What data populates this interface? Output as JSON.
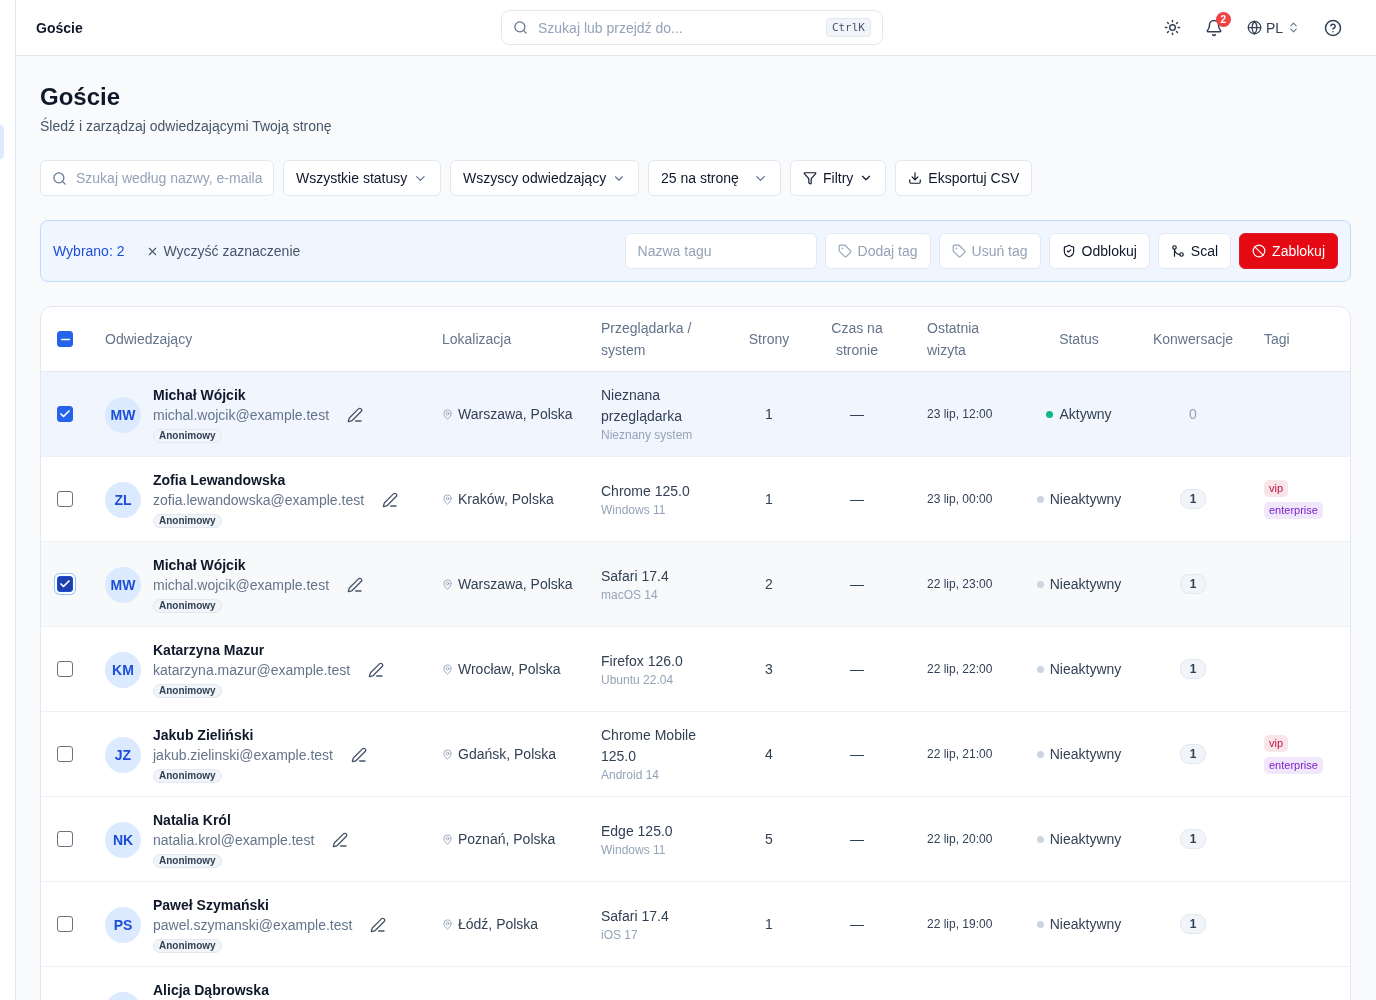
{
  "top_bar": {
    "title": "Goście",
    "search": {
      "placeholder": "Szukaj lub przejdź do...",
      "shortcut": "CtrlK"
    },
    "notifications": {
      "count": "2"
    },
    "language": "PL"
  },
  "page": {
    "title": "Goście",
    "subtitle": "Śledź i zarządzaj odwiedzającymi Twoją stronę"
  },
  "filters": {
    "search": {
      "placeholder": "Szukaj według nazwy, e-maila"
    },
    "selects": [
      "Wszystkie statusy",
      "Wszyscy odwiedzający",
      "25 na stronę"
    ],
    "buttons": [
      {
        "label": "Filtry",
        "kind": "menu"
      },
      {
        "label": "Eksportuj CSV",
        "kind": "export"
      }
    ]
  },
  "selection_bar": {
    "count_label": "Wybrano: 2",
    "clear_label": "Wyczyść zaznaczenie",
    "tag_input": {
      "placeholder": "Nazwa tagu"
    },
    "actions": [
      {
        "label": "Dodaj tag",
        "kind": "tag",
        "disabled": true
      },
      {
        "label": "Usuń tag",
        "kind": "tag",
        "disabled": true
      },
      {
        "label": "Odblokuj",
        "kind": "unblock",
        "disabled": false
      },
      {
        "label": "Scal",
        "kind": "merge",
        "disabled": false
      },
      {
        "label": "Zablokuj",
        "kind": "block",
        "disabled": false
      }
    ]
  },
  "table": {
    "select_all": {
      "indeterminate": true
    },
    "columns": [
      "Odwiedzający",
      "Lokalizacja",
      "Przeglądarka / system",
      "Strony",
      "Czas na stronie",
      "Ostatnia wizyta",
      "Status",
      "Konwersacje",
      "Tagi"
    ],
    "rows": [
      {
        "selected": true,
        "focused": false,
        "initials": "MW",
        "name": "Michał Wójcik",
        "email": "michal.wojcik@example.test",
        "badge": "Anonimowy",
        "location": "Warszawa, Polska",
        "browser": "Nieznana przeglądarka",
        "os": "Nieznany system",
        "pages": "1",
        "time_on_page": "—",
        "last_visit": "23 lip, 12:00",
        "status": {
          "label": "Aktywny",
          "active": true
        },
        "conversations": {
          "value": "0",
          "kind": "plain"
        },
        "tags": []
      },
      {
        "selected": false,
        "focused": false,
        "initials": "ZL",
        "name": "Zofia Lewandowska",
        "email": "zofia.lewandowska@example.test",
        "badge": "Anonimowy",
        "location": "Kraków, Polska",
        "browser": "Chrome 125.0",
        "os": "Windows 11",
        "pages": "1",
        "time_on_page": "—",
        "last_visit": "23 lip, 00:00",
        "status": {
          "label": "Nieaktywny",
          "active": false
        },
        "conversations": {
          "value": "1",
          "kind": "badge"
        },
        "tags": [
          {
            "label": "vip",
            "color": "#be123c"
          },
          {
            "label": "enterprise",
            "color": "#7e22ce"
          }
        ]
      },
      {
        "selected": true,
        "focused": true,
        "initials": "MW",
        "name": "Michał Wójcik",
        "email": "michal.wojcik@example.test",
        "badge": "Anonimowy",
        "location": "Warszawa, Polska",
        "browser": "Safari 17.4",
        "os": "macOS 14",
        "pages": "2",
        "time_on_page": "—",
        "last_visit": "22 lip, 23:00",
        "status": {
          "label": "Nieaktywny",
          "active": false
        },
        "conversations": {
          "value": "1",
          "kind": "badge"
        },
        "tags": []
      },
      {
        "selected": false,
        "focused": false,
        "initials": "KM",
        "name": "Katarzyna Mazur",
        "email": "katarzyna.mazur@example.test",
        "badge": "Anonimowy",
        "location": "Wrocław, Polska",
        "browser": "Firefox 126.0",
        "os": "Ubuntu 22.04",
        "pages": "3",
        "time_on_page": "—",
        "last_visit": "22 lip, 22:00",
        "status": {
          "label": "Nieaktywny",
          "active": false
        },
        "conversations": {
          "value": "1",
          "kind": "badge"
        },
        "tags": []
      },
      {
        "selected": false,
        "focused": false,
        "initials": "JZ",
        "name": "Jakub Zieliński",
        "email": "jakub.zielinski@example.test",
        "badge": "Anonimowy",
        "location": "Gdańsk, Polska",
        "browser": "Chrome Mobile 125.0",
        "os": "Android 14",
        "pages": "4",
        "time_on_page": "—",
        "last_visit": "22 lip, 21:00",
        "status": {
          "label": "Nieaktywny",
          "active": false
        },
        "conversations": {
          "value": "1",
          "kind": "badge"
        },
        "tags": [
          {
            "label": "vip",
            "color": "#be123c"
          },
          {
            "label": "enterprise",
            "color": "#7e22ce"
          }
        ]
      },
      {
        "selected": false,
        "focused": false,
        "initials": "NK",
        "name": "Natalia Król",
        "email": "natalia.krol@example.test",
        "badge": "Anonimowy",
        "location": "Poznań, Polska",
        "browser": "Edge 125.0",
        "os": "Windows 11",
        "pages": "5",
        "time_on_page": "—",
        "last_visit": "22 lip, 20:00",
        "status": {
          "label": "Nieaktywny",
          "active": false
        },
        "conversations": {
          "value": "1",
          "kind": "badge"
        },
        "tags": []
      },
      {
        "selected": false,
        "focused": false,
        "initials": "PS",
        "name": "Paweł Szymański",
        "email": "pawel.szymanski@example.test",
        "badge": "Anonimowy",
        "location": "Łódź, Polska",
        "browser": "Safari 17.4",
        "os": "iOS 17",
        "pages": "1",
        "time_on_page": "—",
        "last_visit": "22 lip, 19:00",
        "status": {
          "label": "Nieaktywny",
          "active": false
        },
        "conversations": {
          "value": "1",
          "kind": "badge"
        },
        "tags": []
      },
      {
        "selected": false,
        "focused": false,
        "name": "Alicja Dąbrowska"
      }
    ]
  }
}
